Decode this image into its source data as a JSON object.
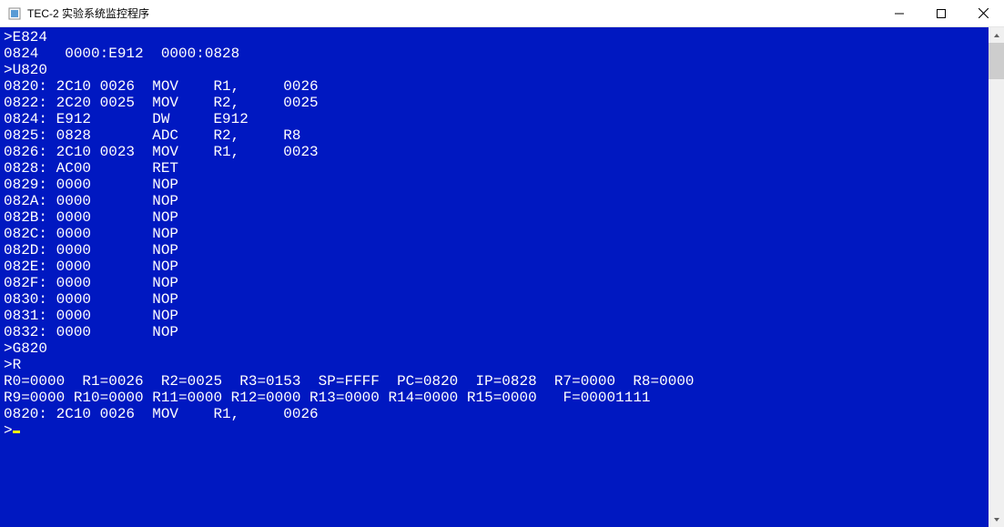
{
  "window": {
    "title": "TEC-2 实验系统监控程序"
  },
  "lines": [
    ">E824",
    "0824   0000:E912  0000:0828",
    ">U820",
    "0820: 2C10 0026  MOV    R1,     0026",
    "0822: 2C20 0025  MOV    R2,     0025",
    "0824: E912       DW     E912",
    "0825: 0828       ADC    R2,     R8",
    "0826: 2C10 0023  MOV    R1,     0023",
    "0828: AC00       RET",
    "0829: 0000       NOP",
    "082A: 0000       NOP",
    "082B: 0000       NOP",
    "082C: 0000       NOP",
    "082D: 0000       NOP",
    "082E: 0000       NOP",
    "082F: 0000       NOP",
    "0830: 0000       NOP",
    "0831: 0000       NOP",
    "0832: 0000       NOP",
    ">G820",
    ">R",
    "R0=0000  R1=0026  R2=0025  R3=0153  SP=FFFF  PC=0820  IP=0828  R7=0000  R8=0000",
    "R9=0000 R10=0000 R11=0000 R12=0000 R13=0000 R14=0000 R15=0000   F=00001111",
    "0820: 2C10 0026  MOV    R1,     0026"
  ],
  "prompt": ">"
}
